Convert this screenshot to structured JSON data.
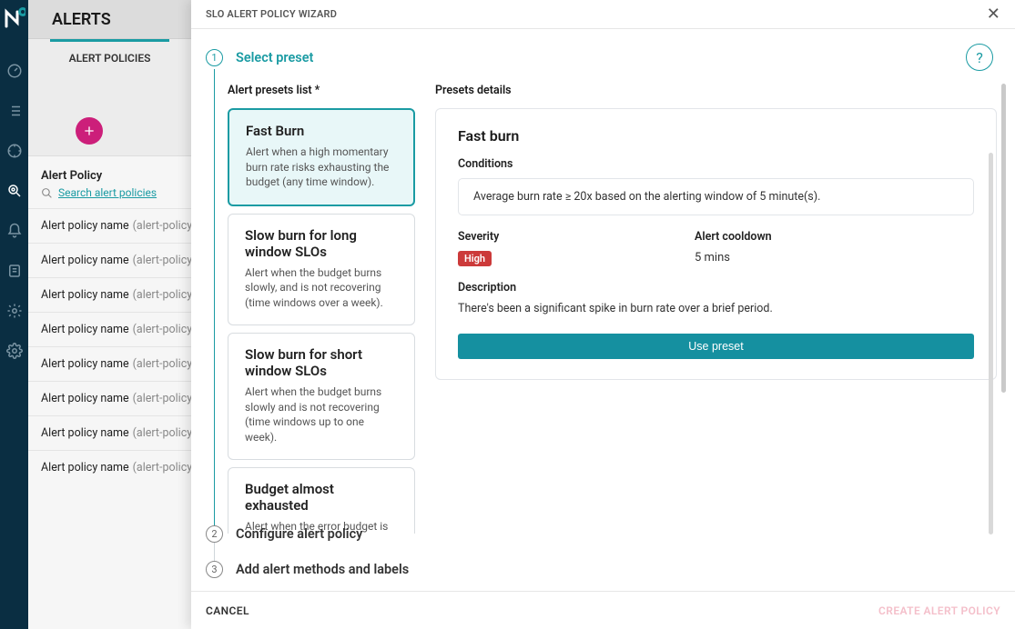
{
  "header": {
    "title": "ALERTS"
  },
  "sidebar": {
    "tab_label": "ALERT POLICIES",
    "panel_title": "Alert Policy",
    "search_link": "Search alert policies",
    "rows": [
      {
        "name": "Alert policy name",
        "suffix": "(alert-policy-"
      },
      {
        "name": "Alert policy name",
        "suffix": "(alert-policy-"
      },
      {
        "name": "Alert policy name",
        "suffix": "(alert-policy-"
      },
      {
        "name": "Alert policy name",
        "suffix": "(alert-policy-"
      },
      {
        "name": "Alert policy name",
        "suffix": "(alert-policy-"
      },
      {
        "name": "Alert policy name",
        "suffix": "(alert-policy-"
      },
      {
        "name": "Alert policy name",
        "suffix": "(alert-policy-"
      },
      {
        "name": "Alert policy name",
        "suffix": "(alert-policy-"
      }
    ]
  },
  "modal": {
    "title": "SLO ALERT POLICY WIZARD",
    "steps": {
      "s1": "Select preset",
      "s2": "Configure alert policy",
      "s3": "Add alert methods and labels"
    },
    "presets_list_label": "Alert presets list *",
    "presets_details_label": "Presets details",
    "presets": [
      {
        "title": "Fast Burn",
        "desc": "Alert when a high momentary burn rate risks exhausting the budget (any time window)."
      },
      {
        "title": "Slow burn for long window SLOs",
        "desc": "Alert when the budget burns slowly, and is not recovering (time windows over a week)."
      },
      {
        "title": "Slow burn for short window SLOs",
        "desc": "Alert when the budget burns slowly and is not recovering (time windows up to one week)."
      },
      {
        "title": "Budget almost exhausted",
        "desc": "Alert when the error budget is"
      }
    ],
    "details": {
      "title": "Fast burn",
      "conditions_label": "Conditions",
      "condition_text": "Average burn rate ≥ 20x based on the alerting window of 5 minute(s).",
      "severity_label": "Severity",
      "severity_value": "High",
      "cooldown_label": "Alert cooldown",
      "cooldown_value": "5 mins",
      "description_label": "Description",
      "description_text": "There's been a significant spike in burn rate over a brief period.",
      "use_button": "Use preset"
    },
    "footer": {
      "cancel": "CANCEL",
      "create": "CREATE ALERT POLICY"
    }
  },
  "icons": {
    "rail": [
      "gauge-icon",
      "list-icon",
      "target-icon",
      "zoom-icon",
      "bell-icon",
      "card-icon",
      "gear-icon",
      "settings-icon"
    ]
  }
}
